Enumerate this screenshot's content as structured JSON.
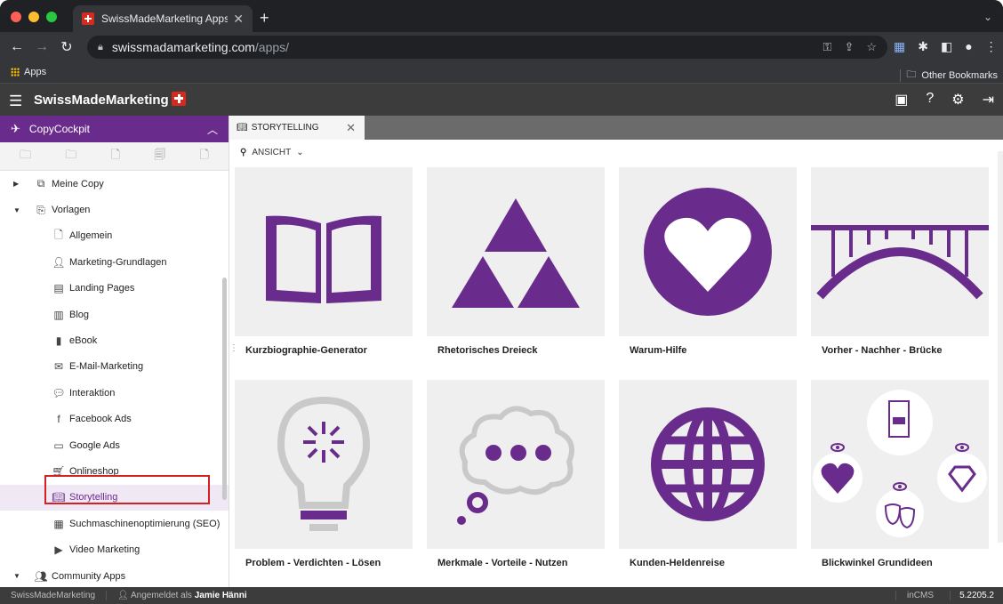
{
  "browser": {
    "tab_title": "SwissMadeMarketing Apps — ",
    "url_host": "swissmadamarketing.com",
    "url_path": "/apps/",
    "bookmark_apps": "Apps",
    "bookmark_other": "Other Bookmarks"
  },
  "app": {
    "brand": "SwissMadeMarketing"
  },
  "sidebar": {
    "header": "CopyCockpit",
    "meine_copy": "Meine Copy",
    "vorlagen": "Vorlagen",
    "items": [
      "Allgemein",
      "Marketing-Grundlagen",
      "Landing Pages",
      "Blog",
      "eBook",
      "E-Mail-Marketing",
      "Interaktion",
      "Facebook Ads",
      "Google Ads",
      "Onlineshop",
      "Storytelling",
      "Suchmaschinenoptimierung (SEO)",
      "Video Marketing"
    ],
    "community": "Community Apps"
  },
  "main": {
    "tab_label": "STORYTELLING",
    "view_label": "ANSICHT",
    "cards": [
      "Kurzbiographie-Generator",
      "Rhetorisches Dreieck",
      "Warum-Hilfe",
      "Vorher - Nachher - Brücke",
      "Problem - Verdichten - Lösen",
      "Merkmale - Vorteile - Nutzen",
      "Kunden-Heldenreise",
      "Blickwinkel Grundideen"
    ]
  },
  "status": {
    "left": "SwissMadeMarketing",
    "logged_prefix": "Angemeldet als",
    "user": "Jamie Hänni",
    "cms": "inCMS",
    "version": "5.2205.2"
  },
  "colors": {
    "brand_purple": "#6a2c8c",
    "swiss_red": "#d52b1e",
    "selection_red": "#d42020"
  }
}
